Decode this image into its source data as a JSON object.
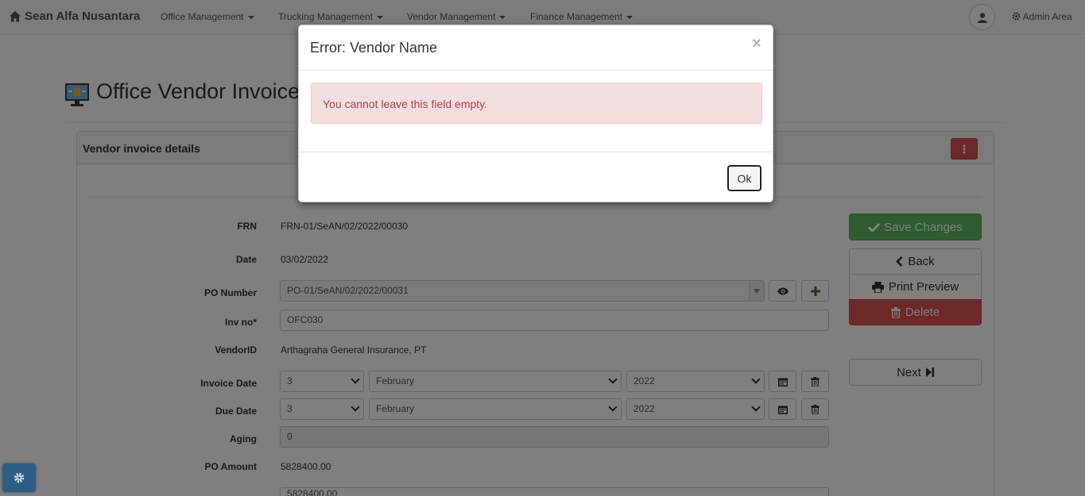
{
  "navbar": {
    "brand": "Sean Alfa Nusantara",
    "menus": [
      "Office Management",
      "Trucking Management",
      "Vendor Management",
      "Finance Management"
    ],
    "admin_label": "Admin Area"
  },
  "page": {
    "title": "Office Vendor Invoice"
  },
  "panel": {
    "title": "Vendor invoice details"
  },
  "form": {
    "frn_label": "FRN",
    "frn_value": "FRN-01/SeAN/02/2022/00030",
    "date_label": "Date",
    "date_value": "03/02/2022",
    "po_number_label": "PO Number",
    "po_number_value": "PO-01/SeAN/02/2022/00031",
    "inv_no_label": "Inv no*",
    "inv_no_value": "OFC030",
    "vendor_id_label": "VendorID",
    "vendor_id_value": "Arthagraha General Insurance, PT",
    "invoice_date_label": "Invoice Date",
    "invoice_date_day": "3",
    "invoice_date_month": "February",
    "invoice_date_year": "2022",
    "due_date_label": "Due Date",
    "due_date_day": "3",
    "due_date_month": "February",
    "due_date_year": "2022",
    "aging_label": "Aging",
    "aging_value": "0",
    "po_amount_label": "PO Amount",
    "po_amount_value": "5828400.00",
    "amount_value": "5828400.00"
  },
  "actions": {
    "save": "Save Changes",
    "back": "Back",
    "print_preview": "Print Preview",
    "delete": "Delete",
    "next": "Next"
  },
  "modal": {
    "title": "Error: Vendor Name",
    "close": "×",
    "message": "You cannot leave this field empty.",
    "ok": "Ok"
  },
  "colors": {
    "success": "#5cb85c",
    "danger": "#d9534f",
    "alert_bg": "#f2dede",
    "alert_text": "#a94442"
  }
}
